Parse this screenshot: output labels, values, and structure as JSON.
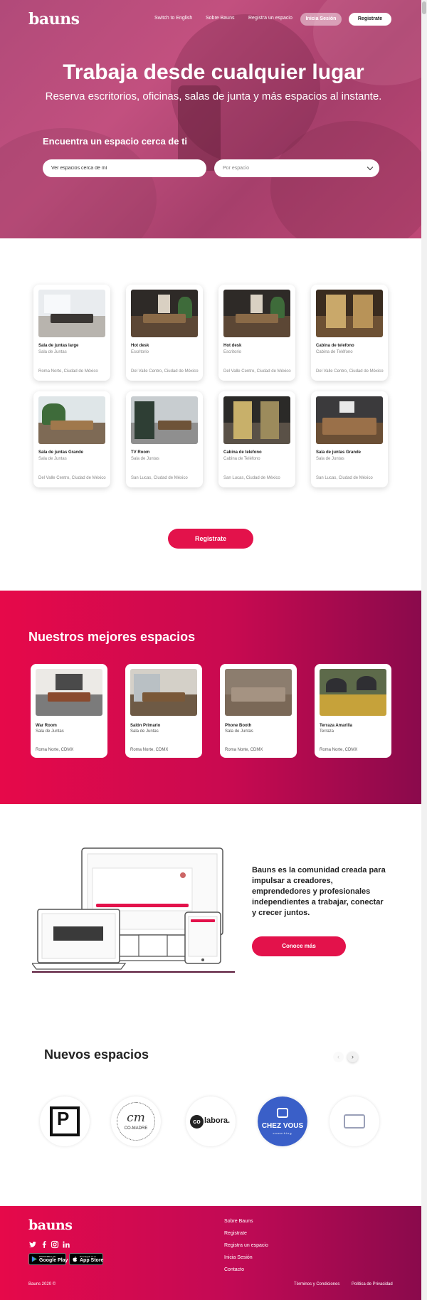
{
  "brand": {
    "logo": "bauns",
    "accent": "#e3124b"
  },
  "nav": {
    "switch_lang": "Switch to English",
    "about": "Sobre Bauns",
    "register_space": "Registra un espacio",
    "login": "Inicia Sesión",
    "signup": "Registrate"
  },
  "hero": {
    "title": "Trabaja desde cualquier lugar",
    "subtitle": "Reserva escritorios, oficinas, salas de junta y más espacios al instante.",
    "find_label": "Encuentra un espacio cerca de ti",
    "search_placeholder": "Ver espacios cerca de mí",
    "select_value": "Por espacio"
  },
  "listings": [
    {
      "title": "Sala de juntas large",
      "type": "Sala de Juntas",
      "location": "Roma Norte, Ciudad de México"
    },
    {
      "title": "Hot desk",
      "type": "Escritorio",
      "location": "Del Valle Centro, Ciudad de México"
    },
    {
      "title": "Hot desk",
      "type": "Escritorio",
      "location": "Del Valle Centro, Ciudad de México"
    },
    {
      "title": "Cabina de telefono",
      "type": "Cabina de Teléfono",
      "location": "Del Valle Centro, Ciudad de México"
    },
    {
      "title": "Sala de juntas Grande",
      "type": "Sala de Juntas",
      "location": "Del Valle Centro, Ciudad de México"
    },
    {
      "title": "TV Room",
      "type": "Sala de Juntas",
      "location": "San Lucas, Ciudad de México"
    },
    {
      "title": "Cabina de telefono",
      "type": "Cabina de Teléfono",
      "location": "San Lucas, Ciudad de México"
    },
    {
      "title": "Sala de juntas Grande",
      "type": "Sala de Juntas",
      "location": "San Lucas, Ciudad de México"
    }
  ],
  "cta_register": "Registrate",
  "best": {
    "title": "Nuestros mejores espacios",
    "items": [
      {
        "title": "War Room",
        "type": "Sala de Juntas",
        "location": "Roma Norte, CDMX"
      },
      {
        "title": "Salón Primario",
        "type": "Sala de Juntas",
        "location": "Roma Norte, CDMX"
      },
      {
        "title": "Phone Booth",
        "type": "Sala de Juntas",
        "location": "Roma Norte, CDMX"
      },
      {
        "title": "Terraza Amarilla",
        "type": "Terraza",
        "location": "Roma Norte, CDMX"
      }
    ]
  },
  "about": {
    "text": "Bauns es la comunidad creada para impulsar a creadores, emprendedores y profesionales independientes a trabajar, conectar y crecer juntos.",
    "button": "Conoce más"
  },
  "new_spaces": {
    "title": "Nuevos espacios",
    "brands": {
      "p": "P",
      "comadre_mark": "cm",
      "comadre_name": "CO-MADRE",
      "colabora_mark": "co",
      "colabora_name": "labora.",
      "chez_name": "CHEZ VOUS",
      "chez_sub": "coworking"
    }
  },
  "footer": {
    "logo": "bauns",
    "links": [
      "Sobre Bauns",
      "Registrate",
      "Registra un espacio",
      "Inicia Sesión",
      "Contacto"
    ],
    "google_play_small": "DISPONIBLE EN",
    "google_play": "Google Play",
    "app_store_small": "Descárgalo en el",
    "app_store": "App Store",
    "copyright": "Bauns 2020 ©",
    "terms": "Términos y Condiciones",
    "privacy": "Política de Privacidad"
  }
}
